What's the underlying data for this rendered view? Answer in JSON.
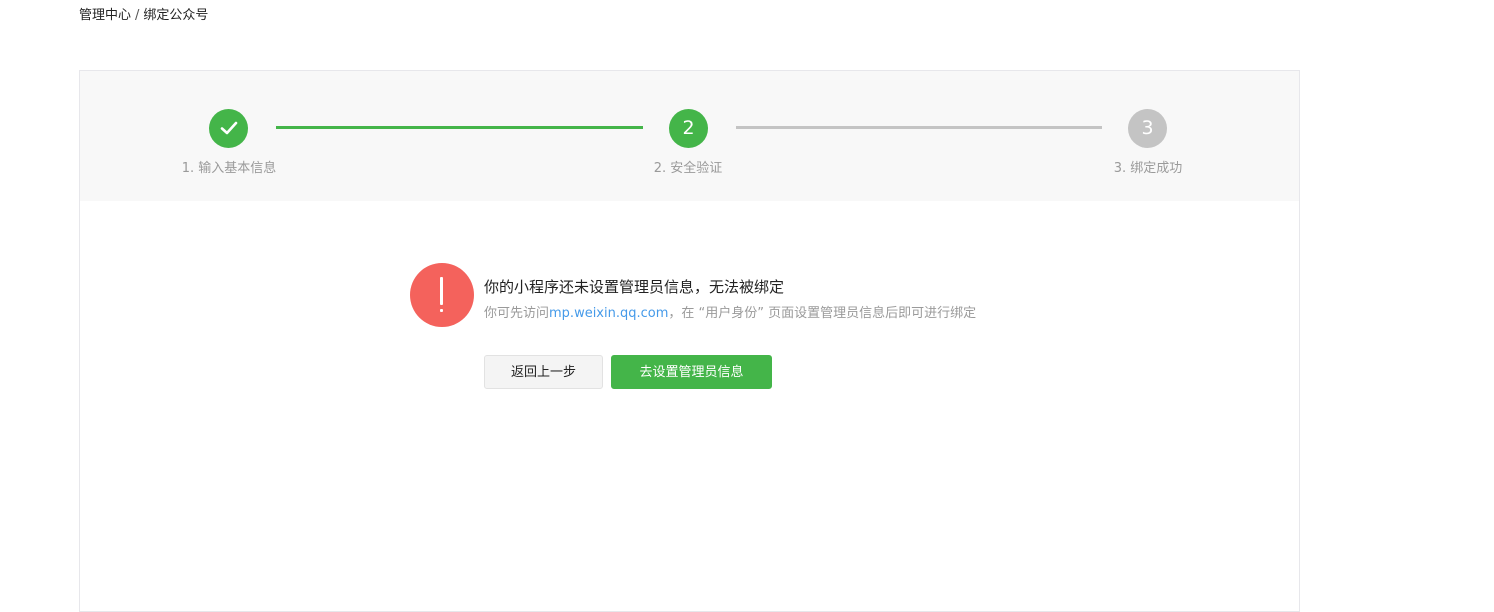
{
  "breadcrumb": {
    "root": "管理中心",
    "separator": "/",
    "current": "绑定公众号"
  },
  "steps": [
    {
      "number": "1",
      "label": "1. 输入基本信息",
      "state": "done"
    },
    {
      "number": "2",
      "label": "2. 安全验证",
      "state": "current"
    },
    {
      "number": "3",
      "label": "3. 绑定成功",
      "state": "todo"
    }
  ],
  "message": {
    "icon": "exclamation-icon",
    "title": "你的小程序还未设置管理员信息，无法被绑定",
    "desc_prefix": "你可先访问",
    "desc_link": "mp.weixin.qq.com",
    "desc_suffix": "，在 “用户身份” 页面设置管理员信息后即可进行绑定"
  },
  "buttons": {
    "back": "返回上一步",
    "primary": "去设置管理员信息"
  },
  "colors": {
    "green": "#44b549",
    "grey": "#c4c4c4",
    "alert": "#f4625c",
    "link": "#459ae9"
  }
}
